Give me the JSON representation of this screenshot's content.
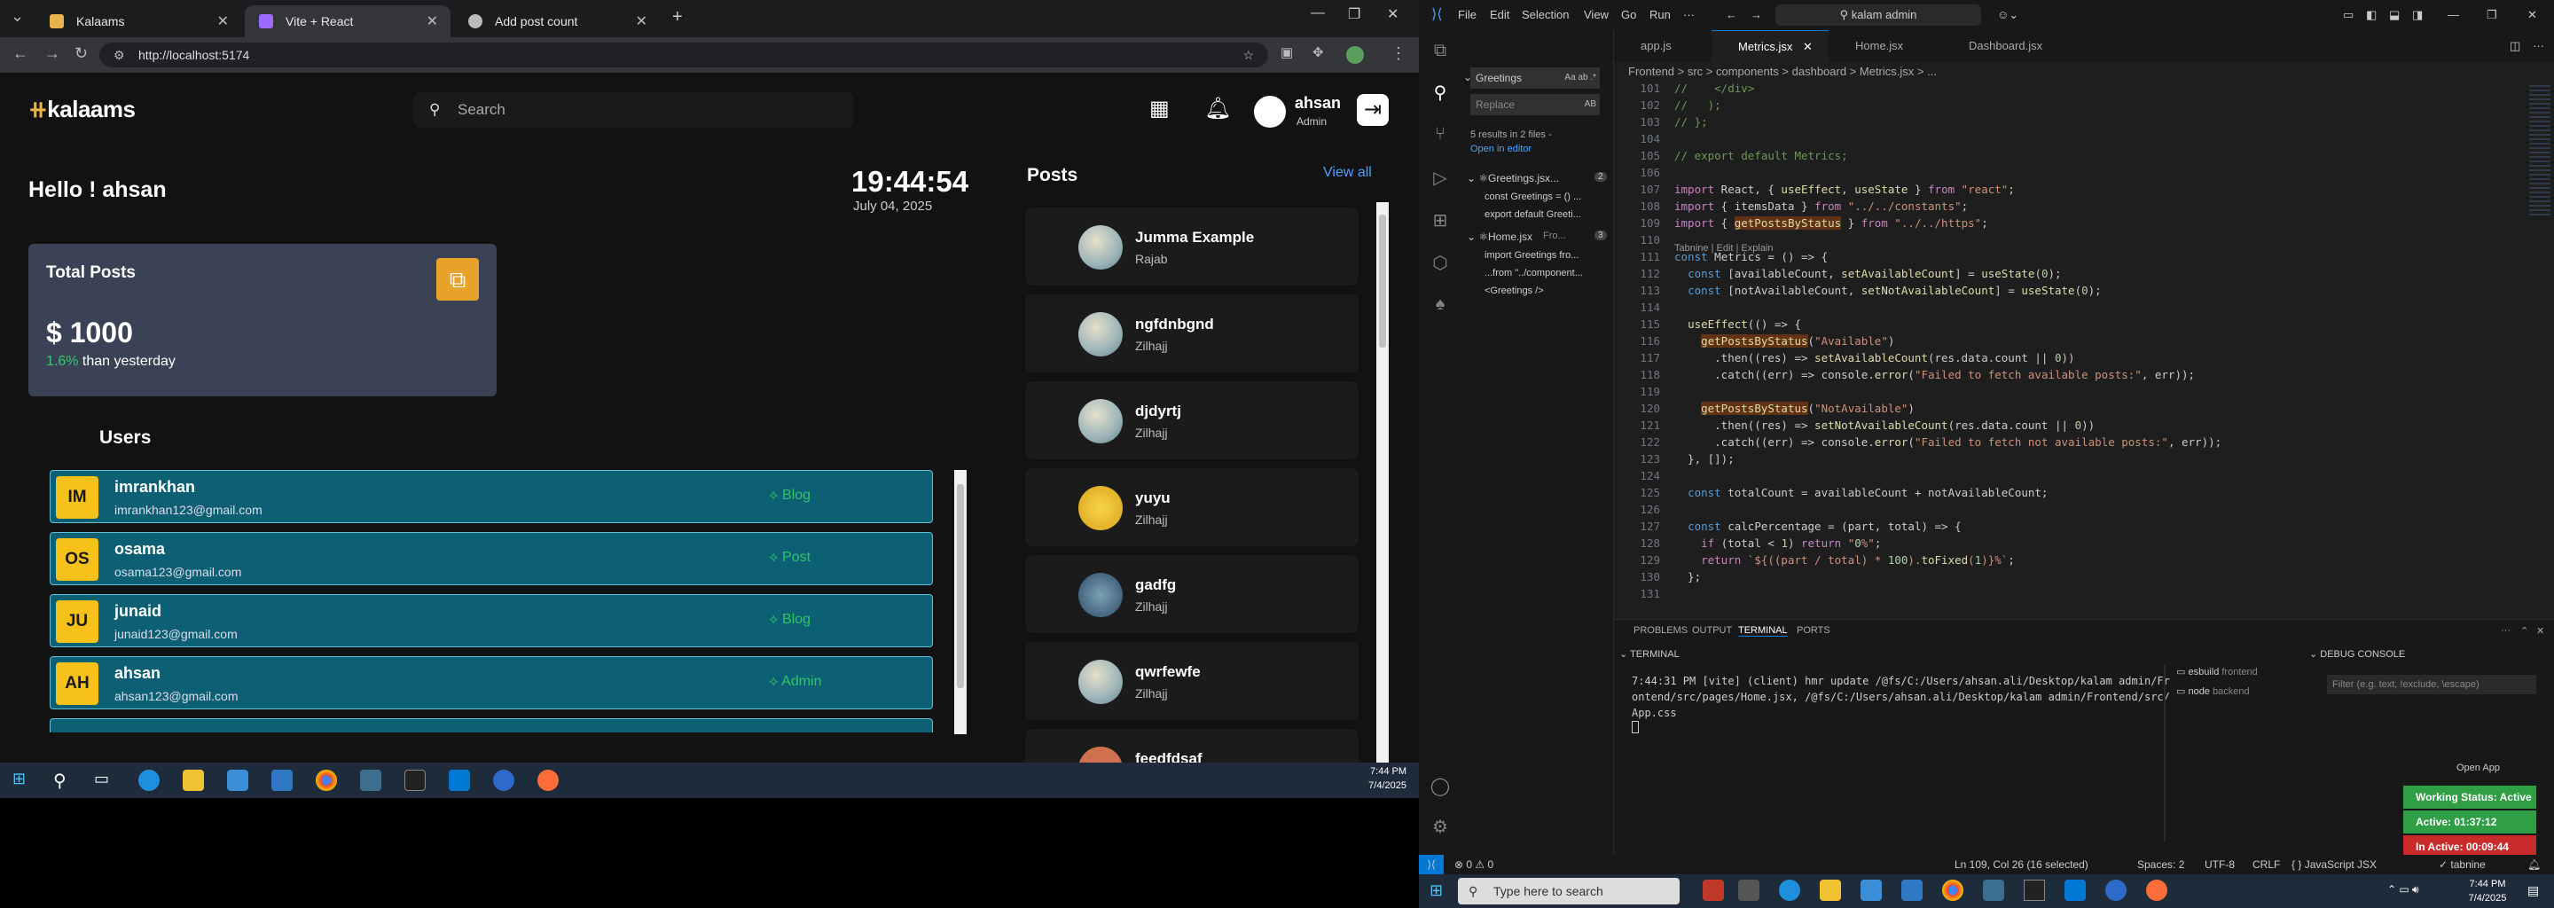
{
  "browser": {
    "tabs": [
      {
        "label": "Kalaams",
        "active": false,
        "color": "#e7b24a"
      },
      {
        "label": "Vite + React",
        "active": true,
        "color": "#9b6bff"
      },
      {
        "label": "Add post count",
        "active": false,
        "color": "#bbbbbb"
      }
    ],
    "url": "http://localhost:5174"
  },
  "app": {
    "logo": "kalaams",
    "search_placeholder": "Search",
    "user": {
      "name": "ahsan",
      "role": "Admin"
    },
    "greeting": "Hello ! ahsan",
    "clock": {
      "time": "19:44:54",
      "date": "July 04, 2025"
    },
    "total_posts": {
      "title": "Total Posts",
      "value": "$ 1000",
      "change": "1.6%",
      "change_text": "than yesterday"
    },
    "users_heading": "Users",
    "users": [
      {
        "initials": "IM",
        "name": "imrankhan",
        "email": "imrankhan123@gmail.com",
        "role": "Blog"
      },
      {
        "initials": "OS",
        "name": "osama",
        "email": "osama123@gmail.com",
        "role": "Post"
      },
      {
        "initials": "JU",
        "name": "junaid",
        "email": "junaid123@gmail.com",
        "role": "Blog"
      },
      {
        "initials": "AH",
        "name": "ahsan",
        "email": "ahsan123@gmail.com",
        "role": "Admin"
      }
    ],
    "posts_heading": "Posts",
    "view_all": "View all",
    "posts": [
      {
        "title": "Jumma Example",
        "author": "Rajab"
      },
      {
        "title": "ngfdnbgnd",
        "author": "Zilhajj"
      },
      {
        "title": "djdyrtj",
        "author": "Zilhajj"
      },
      {
        "title": "yuyu",
        "author": "Zilhajj"
      },
      {
        "title": "gadfg",
        "author": "Zilhajj"
      },
      {
        "title": "qwrfewfe",
        "author": "Zilhajj"
      },
      {
        "title": "feedfdsaf",
        "author": ""
      }
    ]
  },
  "taskbar_left": {
    "time": "7:44 PM",
    "date": "7/4/2025"
  },
  "vscode": {
    "menu": [
      "File",
      "Edit",
      "Selection",
      "View",
      "Go",
      "Run"
    ],
    "command_center": "kalam admin",
    "search": {
      "query": "Greetings",
      "replace_placeholder": "Replace",
      "summary": "5 results in 2 files -",
      "open_in_editor": "Open in editor",
      "files": [
        {
          "name": "Greetings.jsx...",
          "count": "2",
          "matches": [
            "const Greetings = () ...",
            "export default Greeti..."
          ]
        },
        {
          "name": "Home.jsx",
          "path": "Fro...",
          "count": "3",
          "matches": [
            "import Greetings fro...",
            "...from \"../component...",
            "<Greetings />"
          ]
        }
      ]
    },
    "tabs": [
      "app.js",
      "Metrics.jsx",
      "Home.jsx",
      "Dashboard.jsx"
    ],
    "active_tab": "Metrics.jsx",
    "breadcrumb": "Frontend > src > components > dashboard > Metrics.jsx > ...",
    "codelens": "Tabnine | Edit | Explain",
    "code": [
      {
        "n": "101",
        "t": "//    </div>",
        "c": "cm"
      },
      {
        "n": "102",
        "t": "//   );",
        "c": "cm"
      },
      {
        "n": "103",
        "t": "// };",
        "c": "cm"
      },
      {
        "n": "104",
        "t": "",
        "c": ""
      },
      {
        "n": "105",
        "t": "// export default Metrics;",
        "c": "cm"
      },
      {
        "n": "106",
        "t": "",
        "c": ""
      },
      {
        "n": "107",
        "t": "import React, { useEffect, useState } from \"react\";",
        "c": ""
      },
      {
        "n": "108",
        "t": "import { itemsData } from \"../../constants\";",
        "c": ""
      },
      {
        "n": "109",
        "t": "import { getPostsByStatus } from \"../../https\";",
        "c": ""
      },
      {
        "n": "110",
        "t": "",
        "c": ""
      },
      {
        "n": "111",
        "t": "const Metrics = () => {",
        "c": ""
      },
      {
        "n": "112",
        "t": "  const [availableCount, setAvailableCount] = useState(0);",
        "c": ""
      },
      {
        "n": "113",
        "t": "  const [notAvailableCount, setNotAvailableCount] = useState(0);",
        "c": ""
      },
      {
        "n": "114",
        "t": "",
        "c": ""
      },
      {
        "n": "115",
        "t": "  useEffect(() => {",
        "c": ""
      },
      {
        "n": "116",
        "t": "    getPostsByStatus(\"Available\")",
        "c": ""
      },
      {
        "n": "117",
        "t": "      .then((res) => setAvailableCount(res.data.count || 0))",
        "c": ""
      },
      {
        "n": "118",
        "t": "      .catch((err) => console.error(\"Failed to fetch available posts:\", err));",
        "c": ""
      },
      {
        "n": "119",
        "t": "",
        "c": ""
      },
      {
        "n": "120",
        "t": "    getPostsByStatus(\"NotAvailable\")",
        "c": ""
      },
      {
        "n": "121",
        "t": "      .then((res) => setNotAvailableCount(res.data.count || 0))",
        "c": ""
      },
      {
        "n": "122",
        "t": "      .catch((err) => console.error(\"Failed to fetch not available posts:\", err));",
        "c": ""
      },
      {
        "n": "123",
        "t": "  }, []);",
        "c": ""
      },
      {
        "n": "124",
        "t": "",
        "c": ""
      },
      {
        "n": "125",
        "t": "  const totalCount = availableCount + notAvailableCount;",
        "c": ""
      },
      {
        "n": "126",
        "t": "",
        "c": ""
      },
      {
        "n": "127",
        "t": "  const calcPercentage = (part, total) => {",
        "c": ""
      },
      {
        "n": "128",
        "t": "    if (total < 1) return \"0%\";",
        "c": ""
      },
      {
        "n": "129",
        "t": "    return `${((part / total) * 100).toFixed(1)}%`;",
        "c": ""
      },
      {
        "n": "130",
        "t": "  };",
        "c": ""
      },
      {
        "n": "131",
        "t": "",
        "c": ""
      }
    ],
    "panel_tabs": [
      "PROBLEMS",
      "OUTPUT",
      "TERMINAL",
      "PORTS"
    ],
    "panel_active": "TERMINAL",
    "terminal_label": "TERMINAL",
    "debug_label": "DEBUG CONSOLE",
    "debug_filter": "Filter (e.g. text, !exclude, \\escape)",
    "terminal_text": "7:44:31 PM [vite] (client) hmr update /@fs/C:/Users/ahsan.ali/Desktop/kalam admin/Fr\nontend/src/pages/Home.jsx, /@fs/C:/Users/ahsan.ali/Desktop/kalam admin/Frontend/src/\nApp.css",
    "terminals": [
      {
        "name": "esbuild",
        "label": "frontend"
      },
      {
        "name": "node",
        "label": "backend"
      }
    ],
    "open_app": "Open App",
    "badges": [
      {
        "label": "Working Status: Active",
        "color": "#2f9e44"
      },
      {
        "label": "Active: 01:37:12",
        "color": "#2f9e44"
      },
      {
        "label": "In Active: 00:09:44",
        "color": "#c92a2a"
      }
    ],
    "statusbar": {
      "errors": "0",
      "warnings": "0",
      "position": "Ln 109, Col 26 (16 selected)",
      "spaces": "Spaces: 2",
      "encoding": "UTF-8",
      "eol": "CRLF",
      "language": "JavaScript JSX",
      "tabnine": "tabnine"
    }
  },
  "taskbar_right": {
    "search_placeholder": "Type here to search",
    "time": "7:44 PM",
    "date": "7/4/2025"
  }
}
